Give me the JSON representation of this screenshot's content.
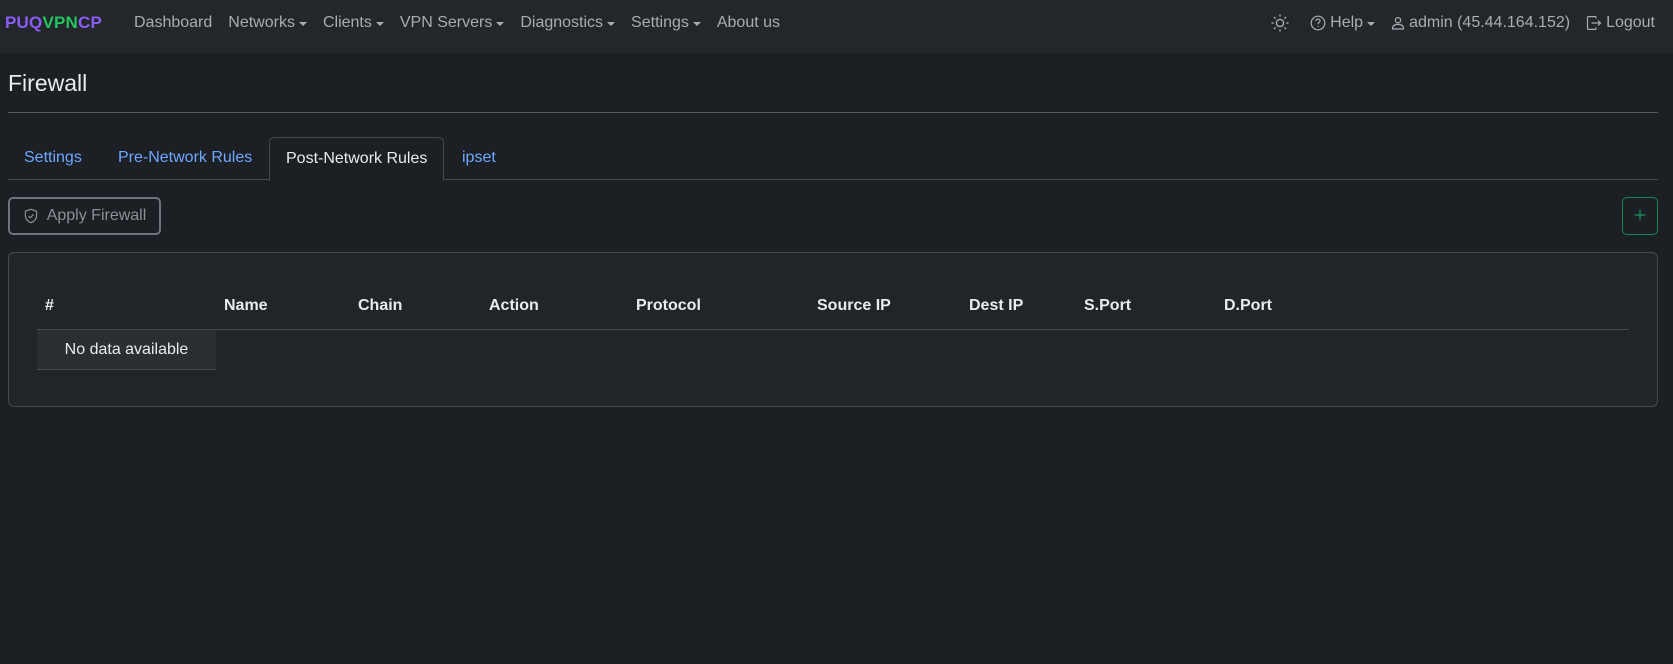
{
  "brand": {
    "part1": "PUQ",
    "part2": "VPN",
    "part3": "CP"
  },
  "nav": {
    "dashboard": "Dashboard",
    "networks": "Networks",
    "clients": "Clients",
    "vpn_servers": "VPN Servers",
    "diagnostics": "Diagnostics",
    "settings": "Settings",
    "about": "About us"
  },
  "user_nav": {
    "theme_icon": "sun-icon",
    "help": "Help",
    "user": "admin (45.44.164.152)",
    "logout": "Logout"
  },
  "page": {
    "title": "Firewall"
  },
  "tabs": [
    {
      "label": "Settings",
      "active": false
    },
    {
      "label": "Pre-Network Rules",
      "active": false
    },
    {
      "label": "Post-Network Rules",
      "active": true
    },
    {
      "label": "ipset",
      "active": false
    }
  ],
  "toolbar": {
    "apply_label": "Apply Firewall",
    "add_icon": "plus-icon"
  },
  "table": {
    "columns": [
      "#",
      "Name",
      "Chain",
      "Action",
      "Protocol",
      "Source IP",
      "Dest IP",
      "S.Port",
      "D.Port"
    ],
    "empty_message": "No data available"
  },
  "colors": {
    "brand_purple": "#8b5cf6",
    "brand_green": "#22c55e",
    "link_blue": "#6ea8fe",
    "success_green": "#198754"
  }
}
